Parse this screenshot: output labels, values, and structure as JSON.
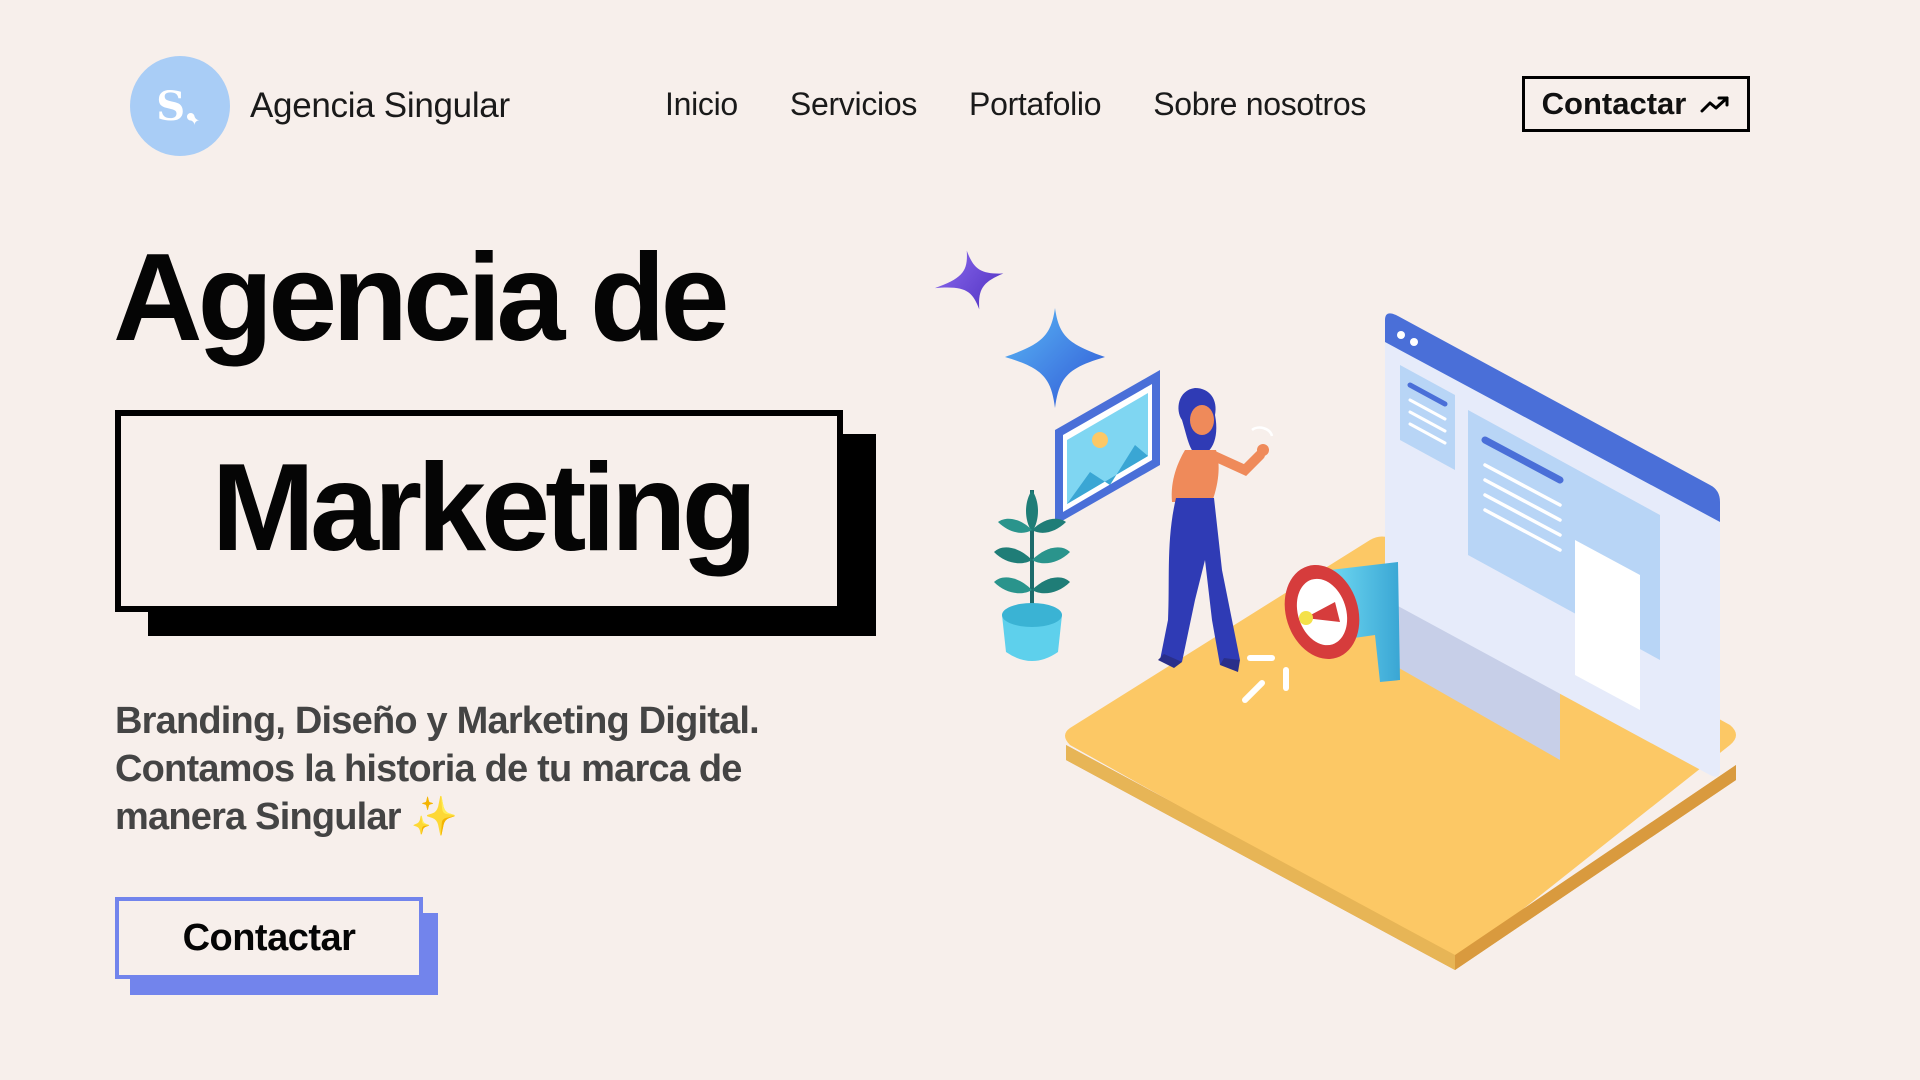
{
  "header": {
    "logo_letter": "S.",
    "brand_name": "Agencia Singular",
    "nav": [
      {
        "label": "Inicio"
      },
      {
        "label": "Servicios"
      },
      {
        "label": "Portafolio"
      },
      {
        "label": "Sobre nosotros"
      }
    ],
    "cta_label": "Contactar",
    "cta_icon": "trending-up-icon"
  },
  "hero": {
    "title_line1": "Agencia de",
    "title_line2": "Marketing",
    "subtitle_lines": [
      "Branding, Diseño y Marketing Digital.",
      "Contamos la historia de tu marca de",
      "manera Singular"
    ],
    "subtitle_emoji": "✨",
    "cta_label": "Contactar"
  },
  "illustration": {
    "description_icon": "isometric-marketing-illustration",
    "elements": [
      "sparkle-icon",
      "browser-window",
      "picture-frame",
      "plant",
      "person",
      "megaphone-icon"
    ]
  },
  "colors": {
    "background": "#f7efeb",
    "logo_badge": "#a9cdf6",
    "cta_accent": "#7284ec",
    "platform": "#fcc865",
    "browser_accent": "#4a6fd8",
    "person": "#2f3bb5"
  }
}
